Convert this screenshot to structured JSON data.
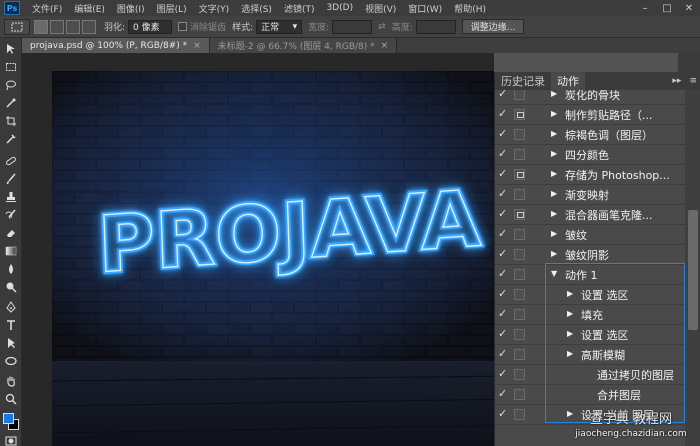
{
  "menubar": {
    "logo": "Ps",
    "items": [
      "文件(F)",
      "编辑(E)",
      "图像(I)",
      "图层(L)",
      "文字(Y)",
      "选择(S)",
      "滤镜(T)",
      "3D(D)",
      "视图(V)",
      "窗口(W)",
      "帮助(H)"
    ],
    "window_controls": [
      "–",
      "□",
      "✕"
    ]
  },
  "options": {
    "feather_label": "羽化:",
    "feather_value": "0 像素",
    "antialias_label": "消除锯齿",
    "style_label": "样式:",
    "style_value": "正常",
    "width_label": "宽度:",
    "height_label": "高度:",
    "refine_button": "调整边缘..."
  },
  "tabs": [
    {
      "label": "projava.psd @ 100% (P, RGB/8#) *",
      "close": "×"
    },
    {
      "label": "未标题-2 @ 66.7% (图层 4, RGB/8) *",
      "close": "×"
    }
  ],
  "canvas": {
    "neon_text": "PROJAVA",
    "neon_color": "#3aa6ff",
    "wall_color": "#1b1f2c"
  },
  "panel": {
    "tab_history": "历史记录",
    "tab_actions": "动作",
    "collapse": "▸▸",
    "menu": "≡",
    "rows": [
      {
        "label": "炭化的骨块",
        "dialog": false,
        "expand": "▶"
      },
      {
        "label": "制作剪贴路径（...",
        "dialog": true,
        "expand": "▶"
      },
      {
        "label": "棕褐色调（图层）",
        "dialog": false,
        "expand": "▶"
      },
      {
        "label": "四分颜色",
        "dialog": false,
        "expand": "▶"
      },
      {
        "label": "存储为 Photoshop...",
        "dialog": true,
        "expand": "▶"
      },
      {
        "label": "渐变映射",
        "dialog": false,
        "expand": "▶"
      },
      {
        "label": "混合器画笔克隆...",
        "dialog": true,
        "expand": "▶"
      },
      {
        "label": "皱纹",
        "dialog": false,
        "expand": "▶"
      },
      {
        "label": "皱纹阴影",
        "dialog": false,
        "expand": "▶"
      },
      {
        "label": "动作 1",
        "dialog": false,
        "expand": "▼"
      },
      {
        "label": "设置 选区",
        "dialog": false,
        "expand": "▶"
      },
      {
        "label": "填充",
        "dialog": false,
        "expand": "▶"
      },
      {
        "label": "设置 选区",
        "dialog": false,
        "expand": "▶"
      },
      {
        "label": "高斯模糊",
        "dialog": false,
        "expand": "▶"
      },
      {
        "label": "通过拷贝的图层",
        "dialog": false,
        "expand": ""
      },
      {
        "label": "合并图层",
        "dialog": false,
        "expand": ""
      },
      {
        "label": "设置 当前 图层",
        "dialog": false,
        "expand": "▶"
      }
    ],
    "check": "✓"
  },
  "watermark": {
    "line1": "查字典 教程网",
    "line2": "jiaocheng.chazidian.com"
  },
  "colors": {
    "foreground": "#1778e6",
    "background": "#000000",
    "accent": "#2a83d6"
  }
}
